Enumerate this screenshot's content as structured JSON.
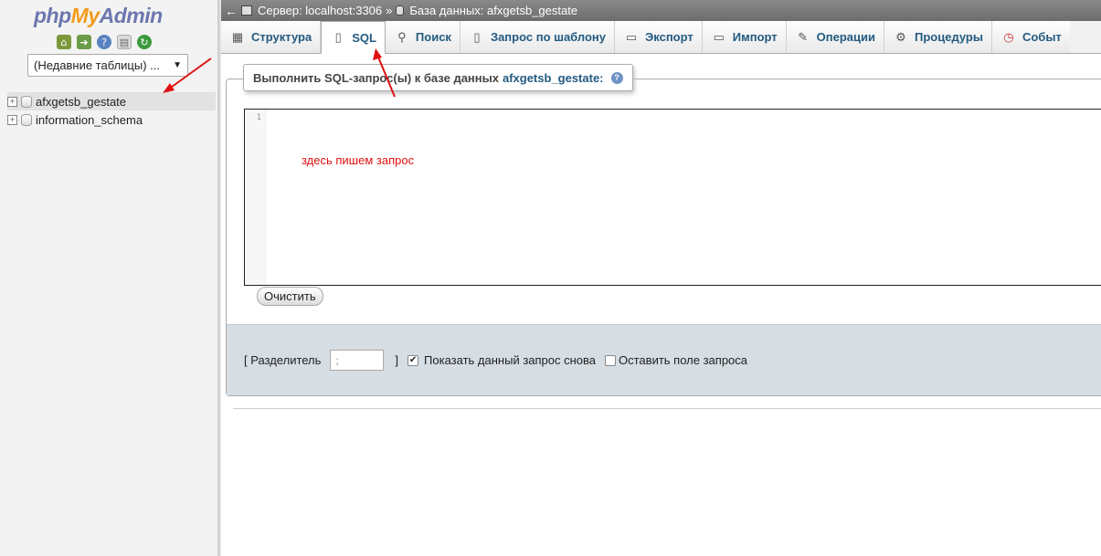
{
  "nav": {
    "logo": {
      "php": "php",
      "my": "My",
      "admin": "Admin"
    },
    "icons": [
      "home-icon",
      "logout-icon",
      "help-icon",
      "docs-icon",
      "reload-icon"
    ],
    "recent_select": "(Недавние таблицы) ...",
    "databases": [
      {
        "name": "afxgetsb_gestate"
      },
      {
        "name": "information_schema"
      }
    ]
  },
  "topbar": {
    "back": "←",
    "server_label": "Сервер: localhost:3306",
    "separator": "»",
    "db_label": "База данных: afxgetsb_gestate"
  },
  "tabs": [
    {
      "label": "Структура",
      "icon": "structure-icon"
    },
    {
      "label": "SQL",
      "icon": "sql-icon"
    },
    {
      "label": "Поиск",
      "icon": "search-icon"
    },
    {
      "label": "Запрос по шаблону",
      "icon": "query-icon"
    },
    {
      "label": "Экспорт",
      "icon": "export-icon"
    },
    {
      "label": "Импорт",
      "icon": "import-icon"
    },
    {
      "label": "Операции",
      "icon": "wrench-icon"
    },
    {
      "label": "Процедуры",
      "icon": "routines-icon"
    },
    {
      "label": "Событ",
      "icon": "clock-icon"
    }
  ],
  "sql": {
    "legend_prefix": "Выполнить SQL-запрос(ы) к базе данных",
    "legend_db": "afxgetsb_gestate:",
    "line_number": "1",
    "editor_note": "здесь пишем запрос",
    "clear_button": "Очистить"
  },
  "options": {
    "delimiter_open": "[ Разделитель",
    "delimiter_value": ";",
    "delimiter_close": "]",
    "show_query": "Показать данный запрос снова",
    "show_query_checked": true,
    "retain_box": "Оставить поле запроса",
    "retain_box_checked": false
  },
  "colors": {
    "annotation": "#e01010",
    "link": "#235a81"
  }
}
